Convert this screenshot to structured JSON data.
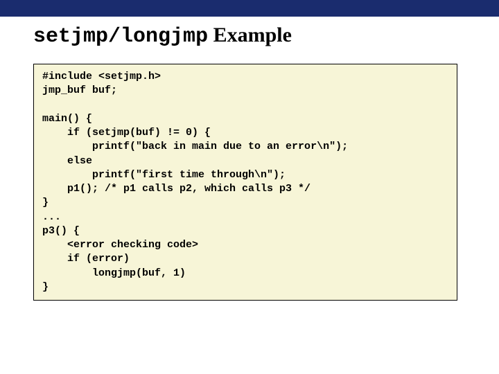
{
  "title": {
    "part1_mono": "setjmp",
    "slash": "/",
    "part2_mono": "longjmp",
    "rest_serif": " Example"
  },
  "code": "#include <setjmp.h>\njmp_buf buf;\n\nmain() {\n    if (setjmp(buf) != 0) {\n        printf(\"back in main due to an error\\n\");\n    else\n        printf(\"first time through\\n\");\n    p1(); /* p1 calls p2, which calls p3 */\n}\n...\np3() {\n    <error checking code>\n    if (error)\n        longjmp(buf, 1)\n}"
}
